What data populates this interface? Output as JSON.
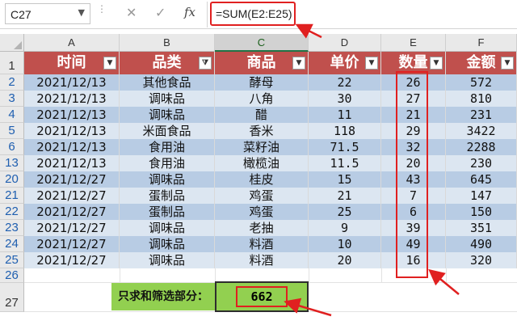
{
  "formula_bar": {
    "name_box": "C27",
    "cancel_icon": "✕",
    "enter_icon": "✓",
    "fx_label": "fx",
    "formula": "=SUM(E2:E25)"
  },
  "columns": [
    "A",
    "B",
    "C",
    "D",
    "E",
    "F"
  ],
  "header_row": {
    "row_number": "1",
    "cells": [
      "时间",
      "品类",
      "商品",
      "单价",
      "数量",
      "金额"
    ]
  },
  "rows": [
    {
      "num": "2",
      "date": "2021/12/13",
      "category": "其他食品",
      "product": "酵母",
      "price": "22",
      "qty": "26",
      "amount": "572"
    },
    {
      "num": "3",
      "date": "2021/12/13",
      "category": "调味品",
      "product": "八角",
      "price": "30",
      "qty": "27",
      "amount": "810"
    },
    {
      "num": "4",
      "date": "2021/12/13",
      "category": "调味品",
      "product": "醋",
      "price": "11",
      "qty": "21",
      "amount": "231"
    },
    {
      "num": "5",
      "date": "2021/12/13",
      "category": "米面食品",
      "product": "香米",
      "price": "118",
      "qty": "29",
      "amount": "3422"
    },
    {
      "num": "6",
      "date": "2021/12/13",
      "category": "食用油",
      "product": "菜籽油",
      "price": "71.5",
      "qty": "32",
      "amount": "2288"
    },
    {
      "num": "13",
      "date": "2021/12/13",
      "category": "食用油",
      "product": "橄榄油",
      "price": "11.5",
      "qty": "20",
      "amount": "230"
    },
    {
      "num": "20",
      "date": "2021/12/27",
      "category": "调味品",
      "product": "桂皮",
      "price": "15",
      "qty": "43",
      "amount": "645"
    },
    {
      "num": "21",
      "date": "2021/12/27",
      "category": "蛋制品",
      "product": "鸡蛋",
      "price": "21",
      "qty": "7",
      "amount": "147"
    },
    {
      "num": "22",
      "date": "2021/12/27",
      "category": "蛋制品",
      "product": "鸡蛋",
      "price": "25",
      "qty": "6",
      "amount": "150"
    },
    {
      "num": "23",
      "date": "2021/12/27",
      "category": "调味品",
      "product": "老抽",
      "price": "9",
      "qty": "39",
      "amount": "351"
    },
    {
      "num": "24",
      "date": "2021/12/27",
      "category": "调味品",
      "product": "料酒",
      "price": "10",
      "qty": "49",
      "amount": "490"
    },
    {
      "num": "25",
      "date": "2021/12/27",
      "category": "调味品",
      "product": "料酒",
      "price": "20",
      "qty": "16",
      "amount": "320"
    }
  ],
  "empty_row_number": "26",
  "summary": {
    "row_number": "27",
    "label": "只求和筛选部分：",
    "total": "662"
  },
  "colors": {
    "header_fill": "#c0504d",
    "band_dark": "#b8cce4",
    "band_light": "#dce6f1",
    "highlight_green": "#92d050",
    "annotation_red": "#e02020"
  }
}
